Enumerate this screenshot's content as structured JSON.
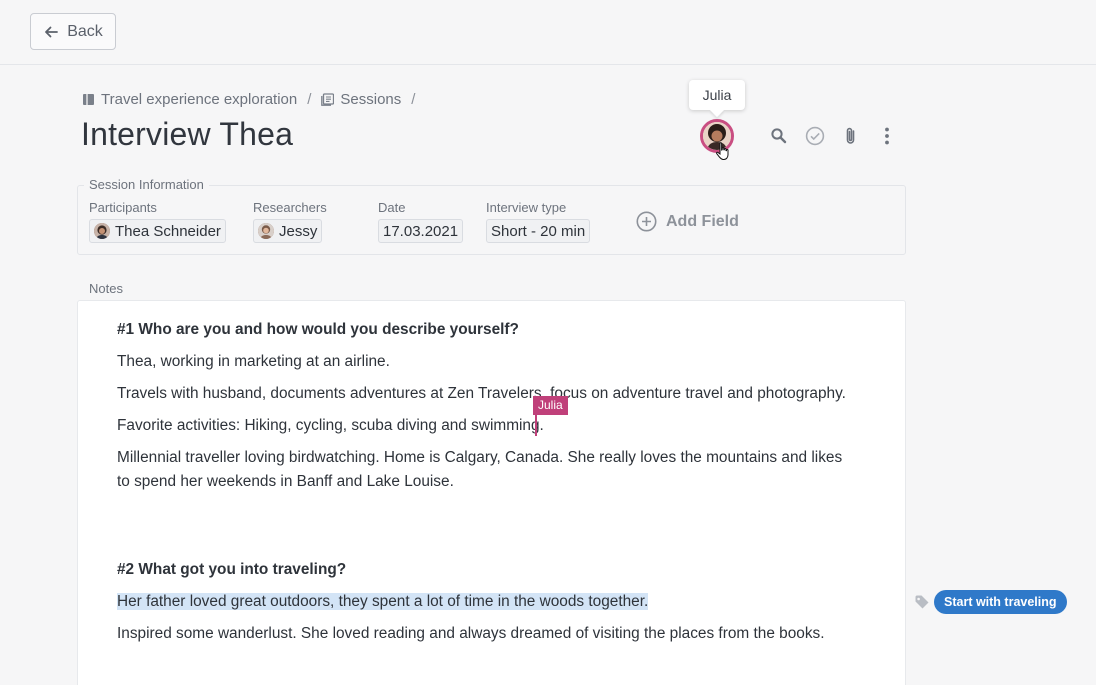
{
  "topbar": {
    "back_label": "Back"
  },
  "breadcrumb": {
    "project": "Travel experience exploration",
    "separator": "/",
    "section": "Sessions",
    "trailing_separator": "/"
  },
  "page": {
    "title": "Interview Thea"
  },
  "presence": {
    "tooltip": "Julia",
    "avatar_ring_color": "#c94e82"
  },
  "toolbar": {
    "icons": [
      "search-icon",
      "check-circle-icon",
      "paperclip-icon",
      "more-vertical-icon"
    ]
  },
  "session": {
    "legend": "Session Information",
    "participants": {
      "label": "Participants",
      "value": "Thea Schneider"
    },
    "researchers": {
      "label": "Researchers",
      "value": "Jessy"
    },
    "date": {
      "label": "Date",
      "value": "17.03.2021"
    },
    "interview_type": {
      "label": "Interview type",
      "value": "Short - 20 min"
    },
    "add_field": "Add Field"
  },
  "notes": {
    "label": "Notes",
    "q1": "#1 Who are you and how would you describe yourself?",
    "p1": "Thea, working in marketing at an airline.",
    "p2": "Travels with husband, documents adventures at Zen Travelers, focus on adventure travel and photography.",
    "p3": "Favorite activities: Hiking, cycling, scuba diving and swimming.",
    "p4": "Millennial traveller loving birdwatching. Home is Calgary, Canada. She really loves the mountains and likes to spend her weekends in Banff and Lake Louise.",
    "q2": "#2 What got you into traveling?",
    "p5": "Her father loved great outdoors, they spent a lot of time in the woods together.",
    "p6": "Inspired some wanderlust. She loved reading and always dreamed of visiting the places from the books."
  },
  "collab_cursor": {
    "name": "Julia",
    "color": "#c0407a"
  },
  "tag": {
    "label": "Start with traveling",
    "color": "#2f79c9"
  }
}
